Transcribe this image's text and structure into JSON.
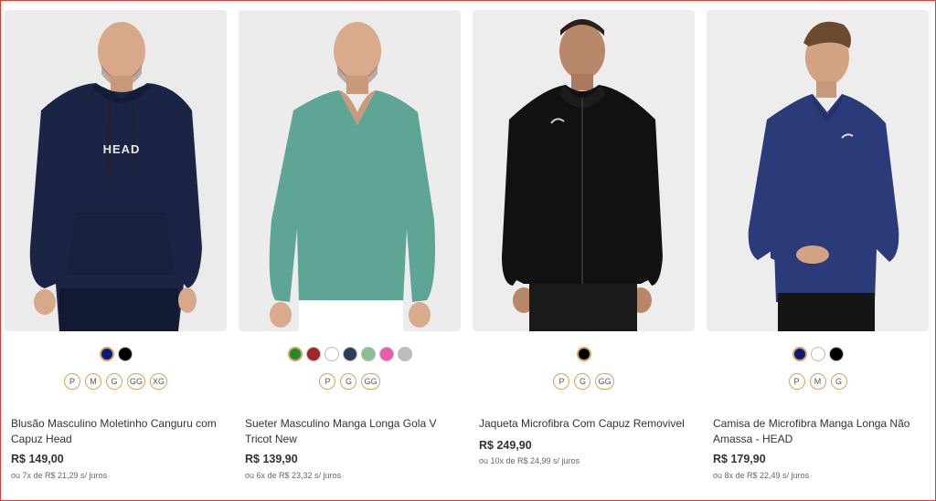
{
  "products": [
    {
      "name": "Blusão Masculino Moletinho Canguru com Capuz Head",
      "price": "R$ 149,00",
      "installments": "ou 7x de R$ 21,29 s/ juros",
      "colors": [
        "#0d1a7a",
        "#000000"
      ],
      "sizes": [
        "P",
        "M",
        "G",
        "GG",
        "XG"
      ],
      "logo_text": "HEAD"
    },
    {
      "name": "Sueter Masculino Manga Longa Gola V Tricot New",
      "price": "R$ 139,90",
      "installments": "ou 6x de R$ 23,32 s/ juros",
      "colors": [
        "#1f8a2a",
        "#a32525",
        "#ffffff",
        "#2c3d60",
        "#8bbf8f",
        "#ee5ab0",
        "#bdbdbd"
      ],
      "sizes": [
        "P",
        "G",
        "GG"
      ]
    },
    {
      "name": "Jaqueta Microfibra Com Capuz Removivel",
      "price": "R$ 249,90",
      "installments": "ou 10x de R$ 24,99 s/ juros",
      "colors": [
        "#000000"
      ],
      "sizes": [
        "P",
        "G",
        "GG"
      ]
    },
    {
      "name": "Camisa de Microfibra Manga Longa Não Amassa - HEAD",
      "price": "R$ 179,90",
      "installments": "ou 8x de R$ 22,49 s/ juros",
      "colors": [
        "#0d1a7a",
        "#ffffff",
        "#000000"
      ],
      "sizes": [
        "P",
        "M",
        "G"
      ]
    }
  ]
}
